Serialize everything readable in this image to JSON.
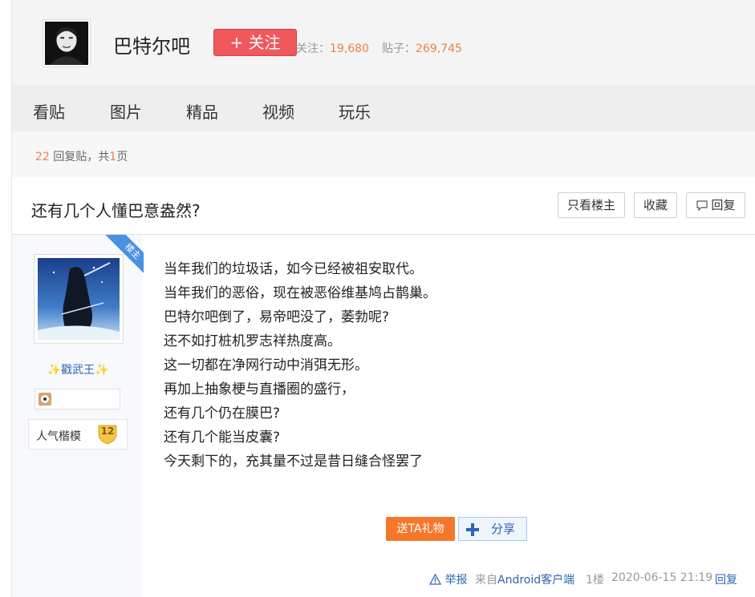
{
  "forum": {
    "name": "巴特尔吧",
    "follow_label": "+ 关注",
    "followers_label": "关注：",
    "followers": "19,680",
    "posts_label": "贴子：",
    "posts": "269,745"
  },
  "nav": {
    "items": [
      {
        "label": "看贴"
      },
      {
        "label": "图片"
      },
      {
        "label": "精品"
      },
      {
        "label": "视频"
      },
      {
        "label": "玩乐"
      }
    ]
  },
  "thread_meta": {
    "reply_count": "22",
    "reply_suffix": "回复贴，共",
    "page_count": "1",
    "page_suffix": "页"
  },
  "thread": {
    "title": "还有几个人懂巴意盎然?",
    "only_op_label": "只看楼主",
    "favorite_label": "收藏",
    "reply_label": "回复"
  },
  "post": {
    "op_badge": "楼主",
    "username": "✨戳武王✨",
    "level_name": "人气楷模",
    "level": "12",
    "lines": [
      "当年我们的垃圾话，如今已经被祖安取代。",
      "当年我们的恶俗，现在被恶俗维基鸠占鹊巢。",
      "巴特尔吧倒了，易帝吧没了，萎勃呢?",
      "还不如打桩机罗志祥热度高。",
      "这一切都在净网行动中消弭无形。",
      "再加上抽象梗与直播圈的盛行，",
      "还有几个仍在膜巴?",
      "还有几个能当皮囊?",
      "今天剩下的，充其量不过是昔日缝合怪罢了"
    ],
    "gift_label": "送TA礼物",
    "share_label": "分享",
    "report_label": "举报",
    "source_prefix": "来自",
    "source_client": "Android客户端",
    "floor": "1楼",
    "time": "2020-06-15 21:19",
    "reply_label": "回复"
  },
  "colors": {
    "follow_button": "#f0585c",
    "accent_orange": "#f08048",
    "link_blue": "#2d64b3",
    "gift_button": "#f5772b",
    "op_ribbon": "#4a90e2"
  }
}
